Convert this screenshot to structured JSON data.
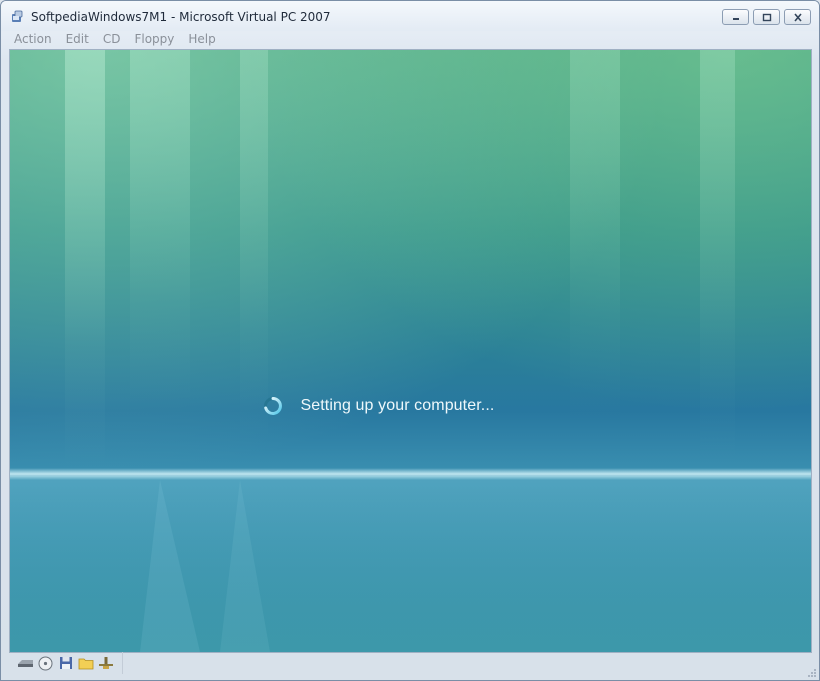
{
  "window": {
    "title": "SoftpediaWindows7M1 - Microsoft Virtual PC 2007",
    "app_icon": "virtual-pc-icon",
    "caption_buttons": [
      "minimize-icon",
      "restore-icon",
      "close-icon"
    ]
  },
  "menubar": {
    "items": [
      "Action",
      "Edit",
      "CD",
      "Floppy",
      "Help"
    ],
    "text_color": "#8a9099"
  },
  "guest_screen": {
    "status_text": "Setting up your computer...",
    "spinner_icon": "busy-spinner-icon",
    "colors": {
      "top": "#3f9b86",
      "middle": "#2a7f92",
      "horizon": "#9fdff0",
      "bottom": "#3c93a8"
    }
  },
  "statusbar": {
    "icons": [
      "hard-disk-icon",
      "cd-drive-icon",
      "floppy-icon",
      "shared-folder-icon",
      "network-icon"
    ]
  }
}
